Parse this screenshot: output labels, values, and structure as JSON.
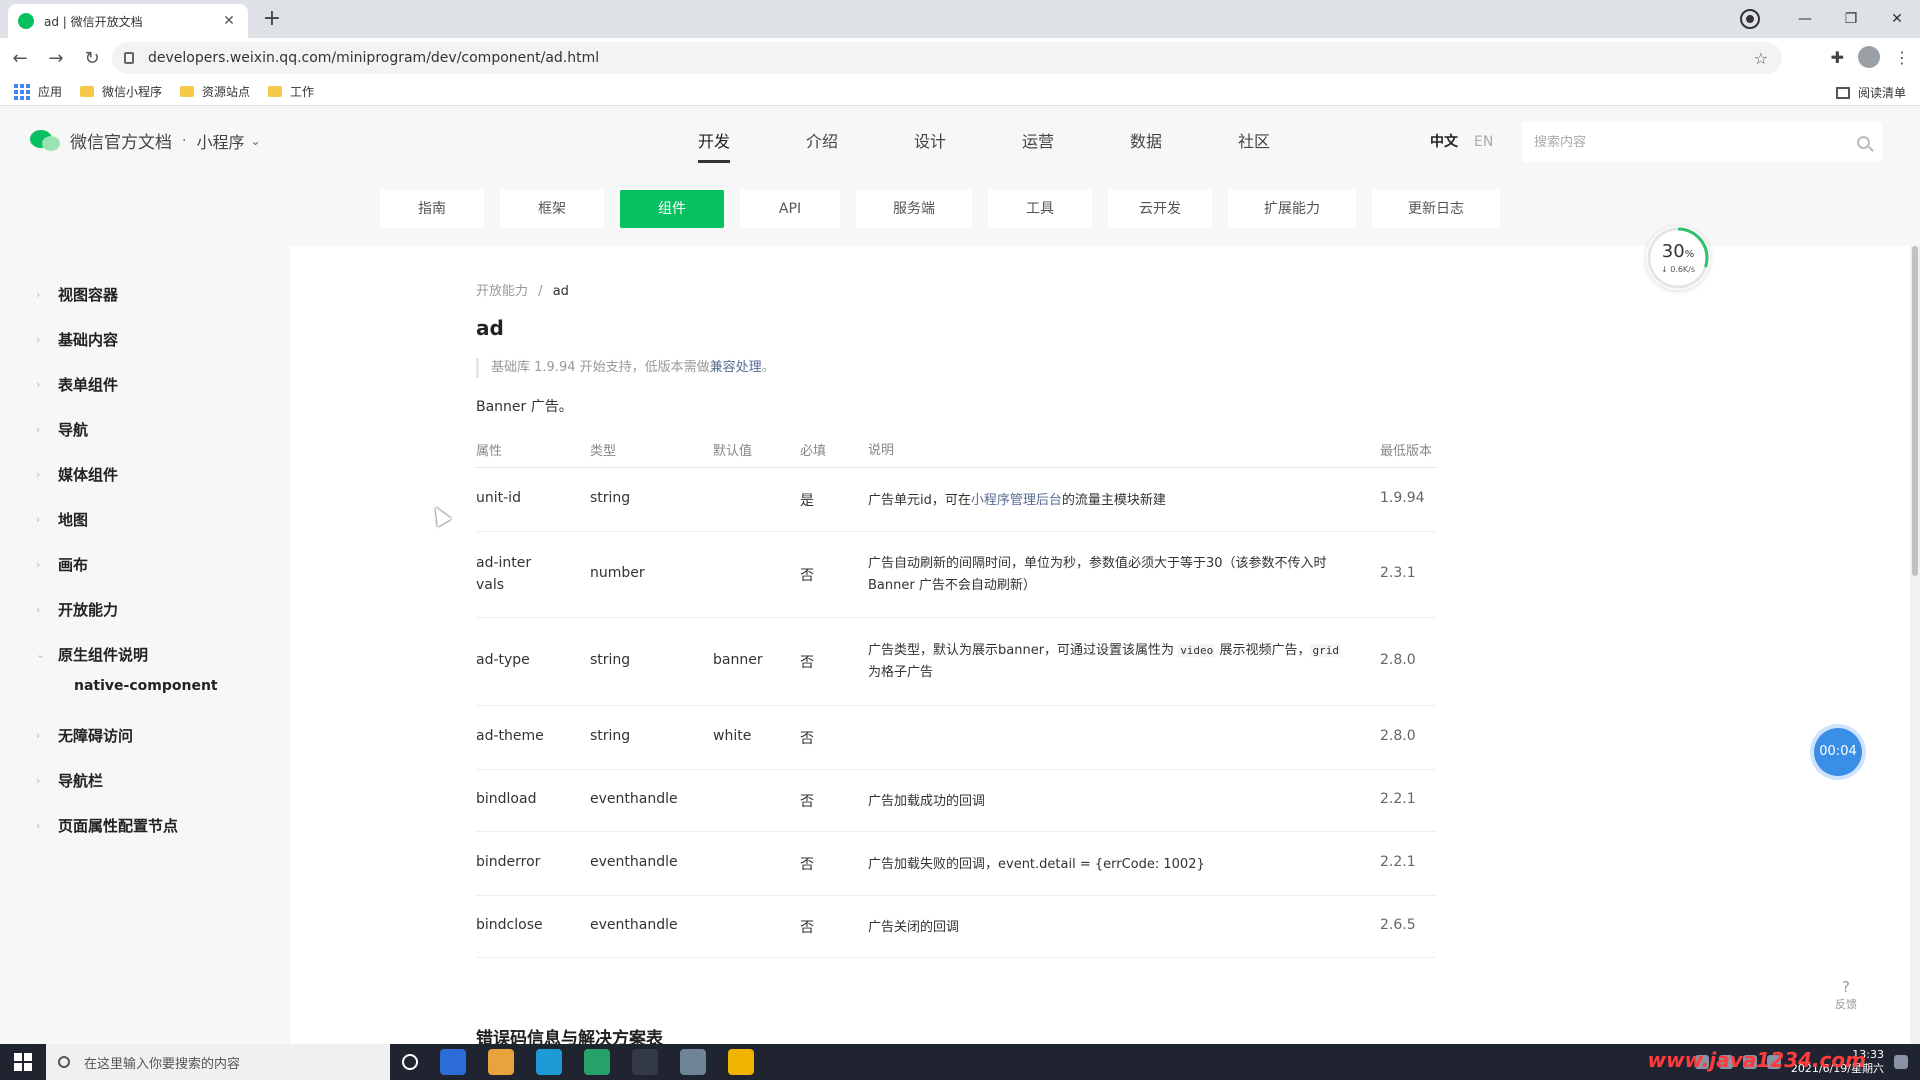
{
  "browser": {
    "tab_title": "ad | 微信开放文档",
    "url": "developers.weixin.qq.com/miniprogram/dev/component/ad.html",
    "bookmarks": [
      "应用",
      "微信小程序",
      "资源站点",
      "工作"
    ],
    "reading_list": "阅读清单"
  },
  "header": {
    "logo_text": "微信官方文档",
    "logo_dot": "·",
    "product": "小程序",
    "nav": [
      "开发",
      "介绍",
      "设计",
      "运营",
      "数据",
      "社区"
    ],
    "nav_active": "开发",
    "lang_zh": "中文",
    "lang_en": "EN",
    "search_placeholder": "搜索内容",
    "subnav": [
      "指南",
      "框架",
      "组件",
      "API",
      "服务端",
      "工具",
      "云开发",
      "扩展能力",
      "更新日志"
    ],
    "subnav_active": "组件"
  },
  "speed_widget": {
    "percent": "30",
    "percent_unit": "%",
    "rate": "↓ 0.6K/s",
    "fill": 0.3,
    "color": "#2dc26b"
  },
  "sidebar": {
    "items": [
      "视图容器",
      "基础内容",
      "表单组件",
      "导航",
      "媒体组件",
      "地图",
      "画布",
      "开放能力",
      "原生组件说明",
      "无障碍访问",
      "导航栏",
      "页面属性配置节点"
    ],
    "expanded_index": 8,
    "sub_item": "native-component"
  },
  "content": {
    "breadcrumb_parent": "开放能力",
    "breadcrumb_sep": "/",
    "breadcrumb_current": "ad",
    "title": "ad",
    "note_text": "基础库 1.9.94 开始支持，低版本需做",
    "note_link": "兼容处理",
    "note_end": "。",
    "description": "Banner 广告。",
    "table": {
      "headers": [
        "属性",
        "类型",
        "默认值",
        "必填",
        "说明",
        "最低版本"
      ],
      "rows": [
        {
          "attr": "unit-id",
          "type": "string",
          "default": "",
          "required": "是",
          "desc_pre": "广告单元id，可在",
          "desc_link": "小程序管理后台",
          "desc_post": "的流量主模块新建",
          "version": "1.9.94"
        },
        {
          "attr": "ad-intervals",
          "type": "number",
          "default": "",
          "required": "否",
          "desc_pre": "广告自动刷新的间隔时间，单位为秒，参数值必须大于等于30（该参数不传入时 Banner 广告不会自动刷新）",
          "desc_link": "",
          "desc_post": "",
          "version": "2.3.1"
        },
        {
          "attr": "ad-type",
          "type": "string",
          "default": "banner",
          "required": "否",
          "desc_pre": "广告类型，默认为展示banner，可通过设置该属性为 ",
          "desc_code1": "video",
          "desc_mid": " 展示视频广告，",
          "desc_code2": "grid",
          "desc_post": " 为格子广告",
          "version": "2.8.0"
        },
        {
          "attr": "ad-theme",
          "type": "string",
          "default": "white",
          "required": "否",
          "desc_pre": "",
          "desc_link": "",
          "desc_post": "",
          "version": "2.8.0"
        },
        {
          "attr": "bindload",
          "type": "eventhandle",
          "default": "",
          "required": "否",
          "desc_pre": "广告加载成功的回调",
          "desc_link": "",
          "desc_post": "",
          "version": "2.2.1"
        },
        {
          "attr": "binderror",
          "type": "eventhandle",
          "default": "",
          "required": "否",
          "desc_pre": "广告加载失败的回调，event.detail = {errCode: 1002}",
          "desc_link": "",
          "desc_post": "",
          "version": "2.2.1"
        },
        {
          "attr": "bindclose",
          "type": "eventhandle",
          "default": "",
          "required": "否",
          "desc_pre": "广告关闭的回调",
          "desc_link": "",
          "desc_post": "",
          "version": "2.6.5"
        }
      ]
    },
    "next_section": "错误码信息与解决方案表"
  },
  "floating": {
    "timer": "00:04",
    "feedback_q": "?",
    "feedback_label": "反馈"
  },
  "taskbar": {
    "search_placeholder": "在这里输入你要搜索的内容",
    "clock_time": "13:33",
    "clock_date": "2021/6/19/星期六",
    "watermark": "www.java1234.com",
    "app_colors": [
      "#2b6cd6",
      "#e8a33d",
      "#1d9bd7",
      "#26a269",
      "#333a46",
      "#6f8396",
      "#f0b400"
    ]
  },
  "colors": {
    "accent": "#07c160",
    "link": "#576b95"
  }
}
